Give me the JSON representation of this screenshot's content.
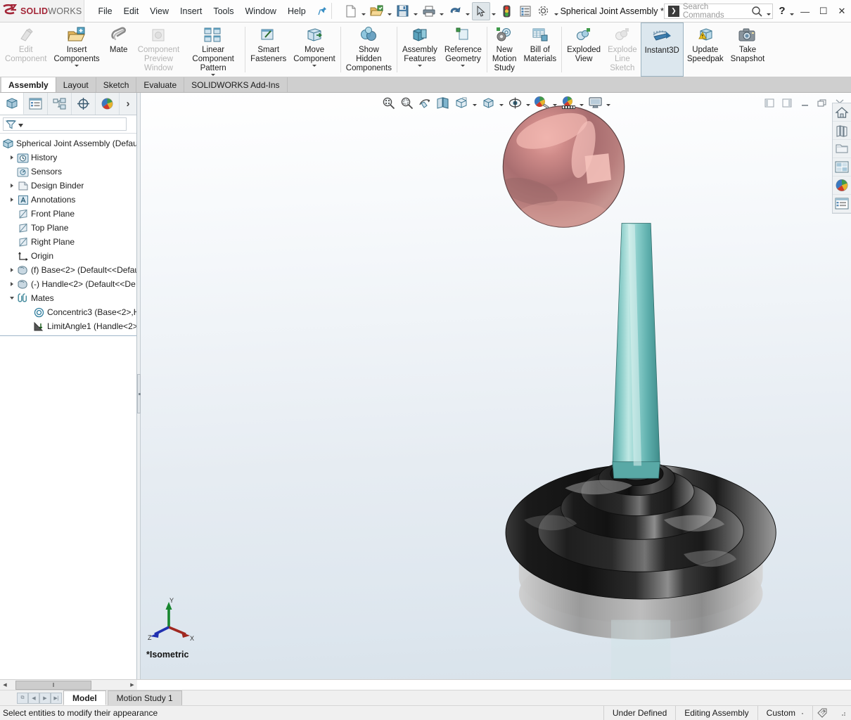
{
  "titlebar": {
    "logo_ds": "3S",
    "logo_solid": "SOLID",
    "logo_works": "WORKS",
    "menus": [
      "File",
      "Edit",
      "View",
      "Insert",
      "Tools",
      "Window",
      "Help"
    ],
    "pin_icon": "pushpin-icon",
    "quick_access": [
      {
        "name": "new-document-icon",
        "caret": true
      },
      {
        "name": "open-document-icon",
        "caret": true
      },
      {
        "name": "save-icon",
        "caret": true
      },
      {
        "name": "print-icon",
        "caret": true
      },
      {
        "name": "undo-icon",
        "caret": true
      },
      {
        "name": "select-arrow-icon",
        "caret": true,
        "selected": true
      },
      {
        "name": "rebuild-icon",
        "caret": false
      },
      {
        "name": "file-properties-icon",
        "caret": false
      },
      {
        "name": "options-gear-icon",
        "caret": true
      }
    ],
    "document_title": "Spherical Joint Assembly *",
    "search": {
      "placeholder": "Search Commands",
      "badge": "❯",
      "icon": "search-magnifier-icon"
    },
    "help_label": "?",
    "window_buttons": {
      "minimize": "—",
      "maximize": "☐",
      "close": "✕"
    }
  },
  "ribbon": {
    "groups": [
      {
        "buttons": [
          {
            "label": "Edit\nComponent",
            "icon": "edit-component-icon",
            "disabled": true,
            "caret": false
          },
          {
            "label": "Insert\nComponents",
            "icon": "insert-components-icon",
            "disabled": false,
            "caret": true
          },
          {
            "label": "Mate",
            "icon": "mate-paperclip-icon",
            "disabled": false,
            "caret": false
          },
          {
            "label": "Component\nPreview\nWindow",
            "icon": "component-preview-window-icon",
            "disabled": true,
            "caret": false
          },
          {
            "label": "Linear Component\nPattern",
            "icon": "linear-component-pattern-icon",
            "disabled": false,
            "caret": true
          }
        ]
      },
      {
        "buttons": [
          {
            "label": "Smart\nFasteners",
            "icon": "smart-fasteners-icon",
            "disabled": false,
            "caret": false
          },
          {
            "label": "Move\nComponent",
            "icon": "move-component-icon",
            "disabled": false,
            "caret": true
          }
        ]
      },
      {
        "buttons": [
          {
            "label": "Show\nHidden\nComponents",
            "icon": "show-hidden-components-icon",
            "disabled": false,
            "caret": false
          }
        ]
      },
      {
        "buttons": [
          {
            "label": "Assembly\nFeatures",
            "icon": "assembly-features-icon",
            "disabled": false,
            "caret": true
          },
          {
            "label": "Reference\nGeometry",
            "icon": "reference-geometry-icon",
            "disabled": false,
            "caret": true
          }
        ]
      },
      {
        "buttons": [
          {
            "label": "New\nMotion\nStudy",
            "icon": "new-motion-study-icon",
            "disabled": false,
            "caret": false
          },
          {
            "label": "Bill of\nMaterials",
            "icon": "bill-of-materials-icon",
            "disabled": false,
            "caret": false
          }
        ]
      },
      {
        "buttons": [
          {
            "label": "Exploded\nView",
            "icon": "exploded-view-icon",
            "disabled": false,
            "caret": false
          },
          {
            "label": "Explode\nLine\nSketch",
            "icon": "explode-line-sketch-icon",
            "disabled": true,
            "caret": false
          },
          {
            "label": "Instant3D",
            "icon": "instant3d-icon",
            "disabled": false,
            "caret": false,
            "active": true
          },
          {
            "label": "Update\nSpeedpak",
            "icon": "update-speedpak-icon",
            "disabled": false,
            "caret": false
          },
          {
            "label": "Take\nSnapshot",
            "icon": "take-snapshot-camera-icon",
            "disabled": false,
            "caret": false
          }
        ]
      }
    ]
  },
  "command_tabs": [
    {
      "label": "Assembly",
      "selected": true
    },
    {
      "label": "Layout",
      "selected": false
    },
    {
      "label": "Sketch",
      "selected": false
    },
    {
      "label": "Evaluate",
      "selected": false
    },
    {
      "label": "SOLIDWORKS Add-Ins",
      "selected": false
    }
  ],
  "feature_manager": {
    "tabs": [
      {
        "name": "feature-manager-design-tree-tab",
        "selected": true
      },
      {
        "name": "property-manager-tab",
        "selected": false
      },
      {
        "name": "configuration-manager-tab",
        "selected": false
      },
      {
        "name": "dimxpert-manager-tab",
        "selected": false
      },
      {
        "name": "display-manager-tab",
        "selected": false
      }
    ],
    "more_tabs_icon": "›",
    "filter_icon": "filter-funnel-icon",
    "tree": [
      {
        "label": "Spherical Joint Assembly  (Defaul",
        "icon": "assembly-icon",
        "indent": 0,
        "arrow": "none"
      },
      {
        "label": "History",
        "icon": "history-clock-icon",
        "indent": 1,
        "arrow": "closed"
      },
      {
        "label": "Sensors",
        "icon": "sensors-icon",
        "indent": 1,
        "arrow": "none"
      },
      {
        "label": "Design Binder",
        "icon": "design-binder-folder-icon",
        "indent": 1,
        "arrow": "closed"
      },
      {
        "label": "Annotations",
        "icon": "annotations-icon",
        "indent": 1,
        "arrow": "closed"
      },
      {
        "label": "Front Plane",
        "icon": "plane-icon",
        "indent": 1,
        "arrow": "none"
      },
      {
        "label": "Top Plane",
        "icon": "plane-icon",
        "indent": 1,
        "arrow": "none"
      },
      {
        "label": "Right Plane",
        "icon": "plane-icon",
        "indent": 1,
        "arrow": "none"
      },
      {
        "label": "Origin",
        "icon": "origin-axes-icon",
        "indent": 1,
        "arrow": "none"
      },
      {
        "label": "(f) Base<2> (Default<<Defau",
        "icon": "part-icon",
        "indent": 1,
        "arrow": "closed"
      },
      {
        "label": "(-) Handle<2> (Default<<De",
        "icon": "part-icon",
        "indent": 1,
        "arrow": "closed"
      },
      {
        "label": "Mates",
        "icon": "mates-paperclips-icon",
        "indent": 1,
        "arrow": "open"
      },
      {
        "label": "Concentric3 (Base<2>,H",
        "icon": "concentric-mate-icon",
        "indent": 2,
        "arrow": "none"
      },
      {
        "label": "LimitAngle1 (Handle<2>",
        "icon": "limit-angle-mate-icon",
        "indent": 2,
        "arrow": "none"
      }
    ]
  },
  "view_toolbar": {
    "buttons": [
      {
        "name": "zoom-to-fit-icon",
        "caret": false
      },
      {
        "name": "zoom-to-area-icon",
        "caret": false
      },
      {
        "name": "rotate-view-icon",
        "caret": false
      },
      {
        "name": "section-view-icon",
        "caret": false
      },
      {
        "name": "view-orientation-icon",
        "caret": true
      },
      {
        "name": "display-style-icon",
        "caret": true
      },
      {
        "name": "hide-show-items-icon",
        "caret": true
      },
      {
        "name": "edit-appearance-icon",
        "caret": true
      },
      {
        "name": "apply-scene-icon",
        "caret": true
      },
      {
        "name": "view-settings-icon",
        "caret": true
      }
    ],
    "window_buttons": [
      {
        "name": "tile-left-icon"
      },
      {
        "name": "tile-right-icon"
      },
      {
        "name": "minimize-document-icon"
      },
      {
        "name": "restore-document-icon"
      },
      {
        "name": "close-document-icon"
      }
    ]
  },
  "task_pane": {
    "buttons": [
      {
        "name": "solidworks-resources-home-icon"
      },
      {
        "name": "design-library-icon"
      },
      {
        "name": "file-explorer-icon"
      },
      {
        "name": "view-palette-icon"
      },
      {
        "name": "appearances-scenes-decals-icon"
      },
      {
        "name": "custom-properties-icon"
      }
    ]
  },
  "viewport": {
    "view_name": "*Isometric",
    "triad": {
      "x_label": "X",
      "y_label": "Y",
      "z_label": "Z",
      "x_color": "#a02820",
      "y_color": "#17862e",
      "z_color": "#2030b0"
    },
    "model": {
      "ball_color": "#b8787a",
      "ball_highlight": "#f0b0ac",
      "shaft_color": "#79c4c0",
      "shaft_highlight": "#bde6e2",
      "base_dark": "#1c1c1c",
      "base_mid": "#3a3a3a",
      "base_light": "#b9b9b9"
    }
  },
  "bottom": {
    "hscroll": {
      "left_arrow": "◀",
      "right_arrow": "▶",
      "thumb_glyph": "‖"
    },
    "nav_buttons": [
      "⧉",
      "◀",
      "▶",
      "▶|"
    ],
    "tabs": [
      {
        "label": "Model",
        "selected": true
      },
      {
        "label": "Motion Study 1",
        "selected": false
      }
    ]
  },
  "status_bar": {
    "message": "Select entities to modify their appearance",
    "defined_state": "Under Defined",
    "edit_mode": "Editing Assembly",
    "units": "Custom",
    "units_caret": "·",
    "tag_icon": "tags-icon"
  }
}
